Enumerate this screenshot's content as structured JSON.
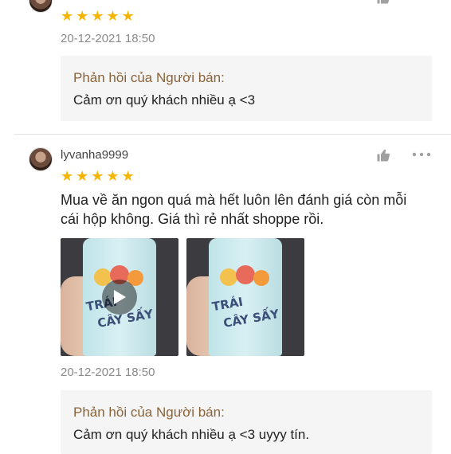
{
  "reviews": [
    {
      "username": "",
      "rating": 5,
      "date": "20-12-2021 18:50",
      "reply": {
        "title": "Phản hồi của Người bán:",
        "text": "Cảm ơn quý khách nhiều ạ <3"
      }
    },
    {
      "username": "lyvanha9999",
      "rating": 5,
      "text_line1": "Mua về ăn ngon quá mà hết luôn lên đánh giá còn mỗi",
      "text_line2": "cái hộp không. Giá thì rẻ nhất shoppe rồi.",
      "media": [
        {
          "type": "video",
          "label_1": "TRÁI",
          "label_2": "CÂY SẤY"
        },
        {
          "type": "image",
          "label_1": "TRÁI",
          "label_2": "CÂY SẤY"
        }
      ],
      "date": "20-12-2021 18:50",
      "reply": {
        "title": "Phản hồi của Người bán:",
        "text": "Cảm ơn quý khách nhiều ạ <3 uyyy tín."
      }
    }
  ],
  "icons": {
    "star": "★",
    "like": "thumbs-up-icon",
    "more": "more-icon",
    "play": "play-icon"
  },
  "colors": {
    "star": "#f7b500",
    "reply_title": "#8a6339",
    "reply_bg": "#f5f5f5"
  }
}
